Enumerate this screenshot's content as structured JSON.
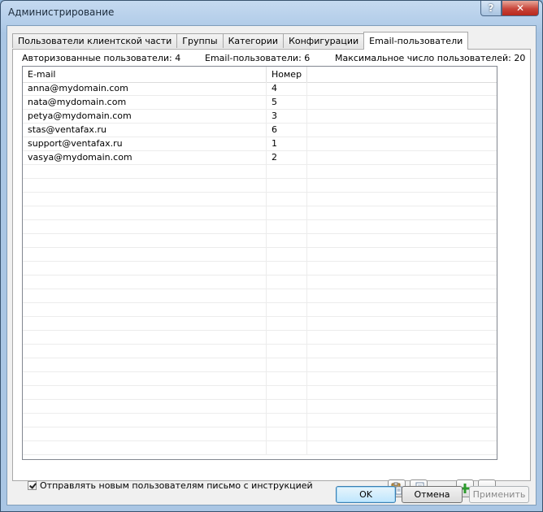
{
  "window": {
    "title": "Администрирование",
    "help_label": "?",
    "close_label": "✕"
  },
  "tabs": [
    {
      "label": "Пользователи клиентской части"
    },
    {
      "label": "Группы"
    },
    {
      "label": "Категории"
    },
    {
      "label": "Конфигурации"
    },
    {
      "label": "Email-пользователи"
    }
  ],
  "stats": {
    "authorized": "Авторизованные пользователи: 4",
    "email_users": "Email-пользователи: 6",
    "max_users": "Максимальное число пользователей: 20"
  },
  "grid": {
    "columns": [
      "E-mail",
      "Номер"
    ],
    "rows": [
      {
        "email": "anna@mydomain.com",
        "number": "4"
      },
      {
        "email": "nata@mydomain.com",
        "number": "5"
      },
      {
        "email": "petya@mydomain.com",
        "number": "3"
      },
      {
        "email": "stas@ventafax.ru",
        "number": "6"
      },
      {
        "email": "support@ventafax.ru",
        "number": "1"
      },
      {
        "email": "vasya@mydomain.com",
        "number": "2"
      }
    ]
  },
  "options": {
    "send_instructions_label": "Отправлять новым пользователям письмо с инструкцией",
    "send_instructions_checked": true
  },
  "buttons": {
    "ok": "OK",
    "cancel": "Отмена",
    "apply": "Применить"
  },
  "icons": {
    "paste": "paste-icon",
    "import": "import-icon",
    "add": "plus-icon",
    "remove": "minus-icon"
  },
  "colors": {
    "add": "#2e9b2e",
    "remove": "#c81e1e",
    "default_button": "#bee6fd"
  }
}
